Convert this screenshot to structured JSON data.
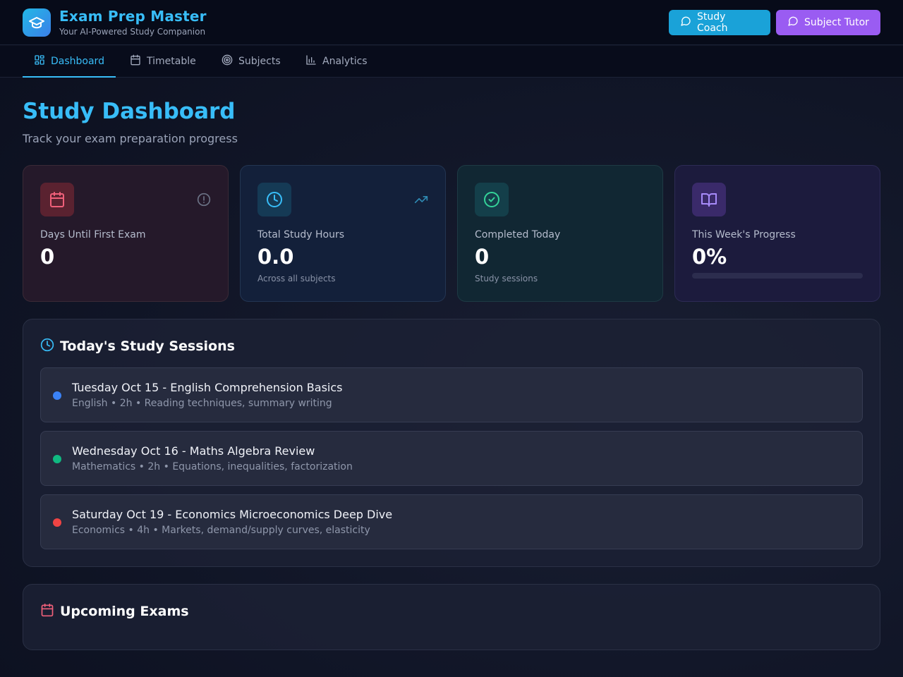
{
  "app": {
    "title": "Exam Prep Master",
    "subtitle": "Your AI-Powered Study Companion"
  },
  "header_buttons": {
    "coach_label": "Study Coach",
    "tutor_label": "Subject Tutor"
  },
  "nav": {
    "tabs": [
      {
        "label": "Dashboard",
        "icon": "grid-icon",
        "active": true
      },
      {
        "label": "Timetable",
        "icon": "calendar-icon",
        "active": false
      },
      {
        "label": "Subjects",
        "icon": "target-icon",
        "active": false
      },
      {
        "label": "Analytics",
        "icon": "bar-chart-icon",
        "active": false
      }
    ]
  },
  "page": {
    "title": "Study Dashboard",
    "subtitle": "Track your exam preparation progress"
  },
  "stats": {
    "days": {
      "label": "Days Until First Exam",
      "value": "0",
      "icon": "calendar-icon",
      "aux_icon": "alert-circle-icon",
      "color": "#f0607a"
    },
    "hours": {
      "label": "Total Study Hours",
      "value": "0.0",
      "note": "Across all subjects",
      "icon": "clock-icon",
      "aux_icon": "trending-up-icon",
      "color": "#38bdf8"
    },
    "completed": {
      "label": "Completed Today",
      "value": "0",
      "note": "Study sessions",
      "icon": "check-circle-icon",
      "color": "#34d399"
    },
    "progress": {
      "label": "This Week's Progress",
      "value": "0%",
      "fraction": 0,
      "icon": "book-open-icon",
      "color": "#a78bfa"
    }
  },
  "sessions": {
    "title": "Today's Study Sessions",
    "items": [
      {
        "title": "Tuesday Oct 15 - English Comprehension Basics",
        "meta": "English • 2h • Reading techniques, summary writing",
        "color": "#3b82f6"
      },
      {
        "title": "Wednesday Oct 16 - Maths Algebra Review",
        "meta": "Mathematics • 2h • Equations, inequalities, factorization",
        "color": "#10b981"
      },
      {
        "title": "Saturday Oct 19 - Economics Microeconomics Deep Dive",
        "meta": "Economics • 4h • Markets, demand/supply curves, elasticity",
        "color": "#ef4444"
      }
    ]
  },
  "exams": {
    "title": "Upcoming Exams"
  }
}
